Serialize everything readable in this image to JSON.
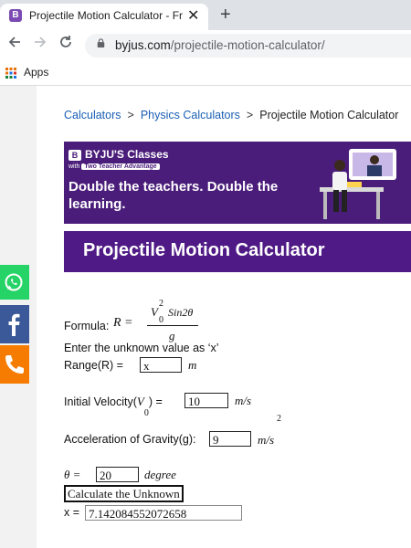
{
  "browser": {
    "tab_title": "Projectile Motion Calculator - Fre",
    "tab_close": "✕",
    "new_tab": "+",
    "url_domain": "byjus.com",
    "url_path": "/projectile-motion-calculator/",
    "apps_label": "Apps"
  },
  "breadcrumb": {
    "link1": "Calculators",
    "sep": ">",
    "link2": "Physics Calculators",
    "current": "Projectile Motion Calculator"
  },
  "banner": {
    "brand": "BYJU'S Classes",
    "badge_with": "with",
    "badge": "Two Teacher Advantage",
    "headline": "Double the teachers. Double the learning."
  },
  "page_title": "Projectile Motion Calculator",
  "calculator": {
    "formula_label": "Formula:",
    "formula_lhs": "R =",
    "formula_V": "V",
    "formula_sub0": "0",
    "formula_sup2": "2",
    "formula_sin": "Sin2θ",
    "formula_den": "g",
    "instruction": "Enter the unknown value as ‘x’",
    "range_label": "Range(R) =",
    "range_value": "x",
    "range_unit": "m",
    "velocity_label_pre": "Initial Velocity(",
    "velocity_label_V": "V",
    "velocity_label_sub": "0",
    "velocity_label_post": ") =",
    "velocity_value": "10",
    "velocity_unit": "m/s",
    "gravity_label": "Acceleration of Gravity(g):",
    "gravity_value": "9",
    "gravity_unit": "m/s",
    "gravity_unit_sup": "2",
    "theta_label": "θ =",
    "theta_value": "20",
    "theta_unit": "degree",
    "button_label": "Calculate the Unknown",
    "result_label": "x =",
    "result_value": "7.142084552072658"
  },
  "colors": {
    "brand_purple": "#4f1a86",
    "link_blue": "#1a5fb4",
    "whatsapp": "#25d366",
    "facebook": "#3b5998",
    "phone": "#f57c00"
  }
}
